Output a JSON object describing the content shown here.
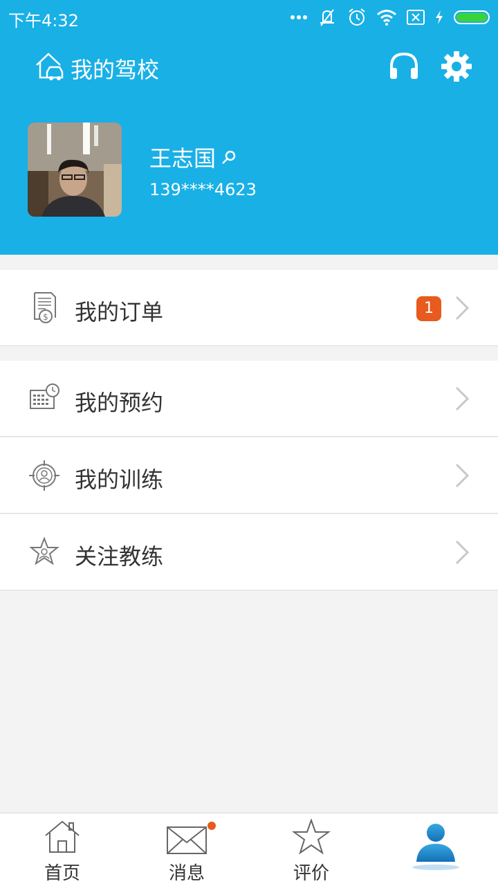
{
  "status_bar": {
    "time": "下午4:32",
    "icons": [
      "more-dots-icon",
      "vibrate-off-icon",
      "alarm-icon",
      "wifi-icon",
      "sim-x-icon",
      "charging-icon",
      "battery-icon"
    ],
    "battery_color": "#3ad43a"
  },
  "header": {
    "title": "我的驾校",
    "title_icon": "home-car-icon",
    "background": "#19b0e6",
    "actions": [
      "headset-icon",
      "gear-icon"
    ]
  },
  "profile": {
    "name": "王志国",
    "phone": "139****4623",
    "edit_icon": "search-edit-icon"
  },
  "menu": {
    "items": [
      {
        "label": "我的订单",
        "icon": "order-bill-icon",
        "badge": "1"
      },
      {
        "label": "我的预约",
        "icon": "calendar-clock-icon"
      },
      {
        "label": "我的训练",
        "icon": "training-target-icon"
      },
      {
        "label": "关注教练",
        "icon": "star-badge-icon"
      }
    ],
    "badge_color": "#e85a1d"
  },
  "tabbar": {
    "tabs": [
      {
        "label": "首页",
        "icon": "home-icon"
      },
      {
        "label": "消息",
        "icon": "mail-icon",
        "dot": true
      },
      {
        "label": "评价",
        "icon": "star-icon"
      },
      {
        "label": "",
        "icon": "user-icon",
        "active": true
      }
    ]
  }
}
